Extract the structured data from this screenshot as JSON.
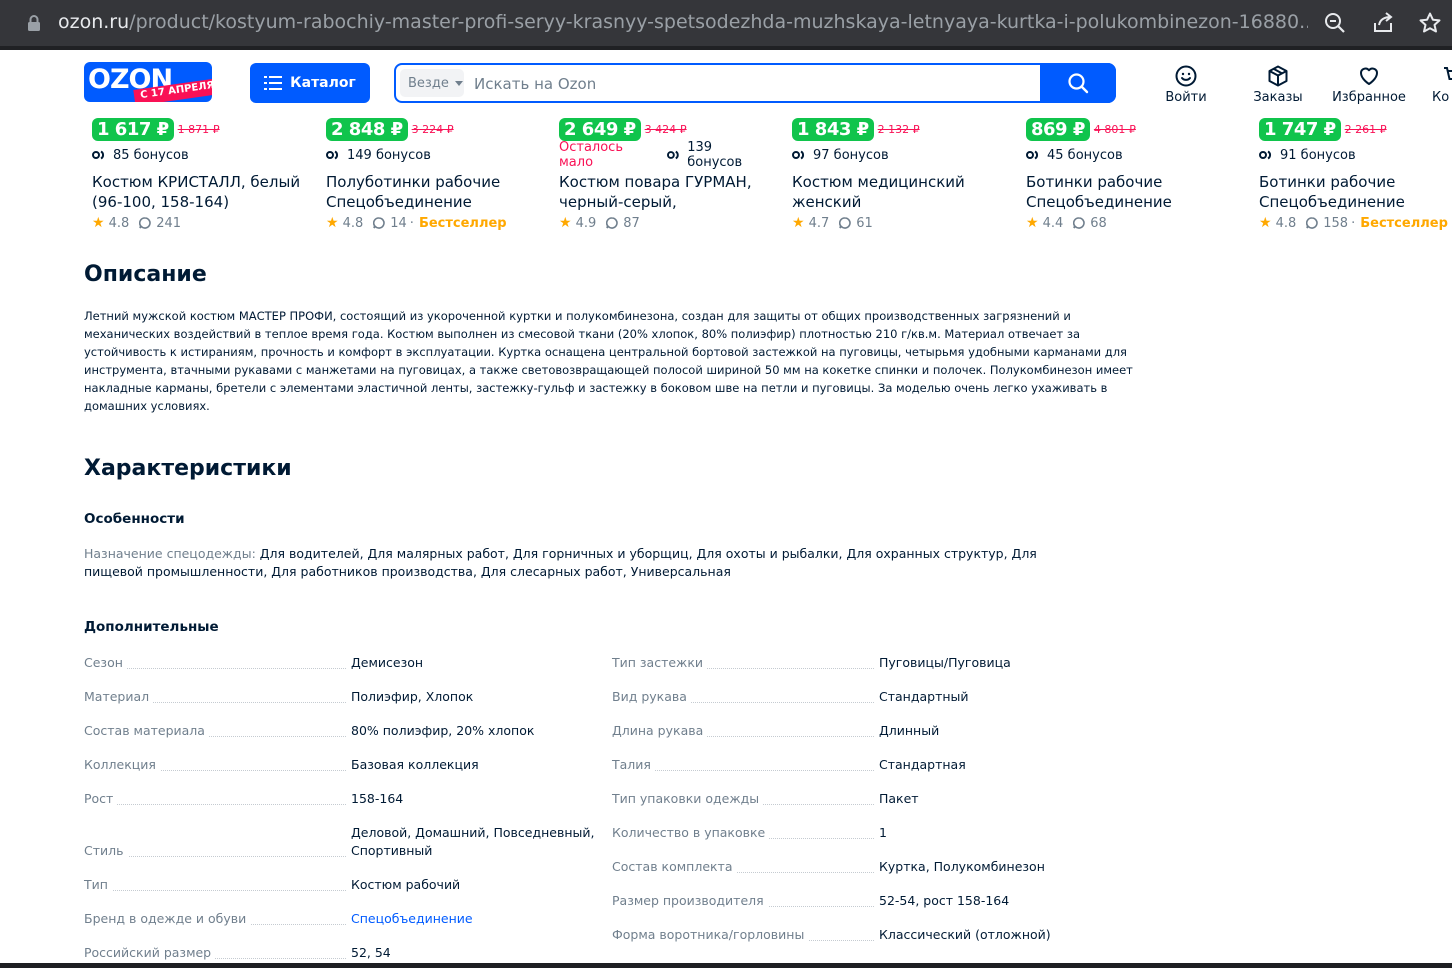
{
  "browser": {
    "url_host": "ozon.ru",
    "url_path": "/product/kostyum-rabochiy-master-profi-seryy-krasnyy-spetsodezhda-muzhskaya-letnyaya-kurtka-i-polukombinezon-16880..."
  },
  "header": {
    "logo_text": "OZON",
    "logo_sub": "С 17 АПРЕЛЯ",
    "catalog_label": "Каталог",
    "search_scope": "Везде",
    "search_placeholder": "Искать на Ozon",
    "actions": [
      {
        "label": "Войти",
        "icon": "smile-icon"
      },
      {
        "label": "Заказы",
        "icon": "box-icon"
      },
      {
        "label": "Избранное",
        "icon": "heart-icon"
      },
      {
        "label": "Ко",
        "icon": "cart-icon"
      }
    ]
  },
  "products": [
    {
      "price": "1 617 ₽",
      "old_price": "1 871 ₽",
      "few_left": "",
      "bonus": "85 бонусов",
      "title": "Костюм КРИСТАЛЛ, белый (96-100, 158-164)",
      "rating": "4.8",
      "reviews": "241",
      "badge": ""
    },
    {
      "price": "2 848 ₽",
      "old_price": "3 224 ₽",
      "few_left": "",
      "bonus": "149 бонусов",
      "title": "Полуботинки рабочие Спецобъединение",
      "rating": "4.8",
      "reviews": "14",
      "badge": "Бестселлер"
    },
    {
      "price": "2 649 ₽",
      "old_price": "3 424 ₽",
      "few_left": "Осталось мало",
      "bonus": "139 бонусов",
      "title": "Костюм повара ГУРМАН, черный-серый, спецодежд...",
      "rating": "4.9",
      "reviews": "87",
      "badge": ""
    },
    {
      "price": "1 843 ₽",
      "old_price": "2 132 ₽",
      "few_left": "",
      "bonus": "97 бонусов",
      "title": "Костюм медицинский женский",
      "rating": "4.7",
      "reviews": "61",
      "badge": ""
    },
    {
      "price": "869 ₽",
      "old_price": "4 801 ₽",
      "few_left": "",
      "bonus": "45 бонусов",
      "title": "Ботинки рабочие Спецобъединение",
      "rating": "4.4",
      "reviews": "68",
      "badge": ""
    },
    {
      "price": "1 747 ₽",
      "old_price": "2 261 ₽",
      "few_left": "",
      "bonus": "91 бонусов",
      "title": "Ботинки рабочие Спецобъединение",
      "rating": "4.8",
      "reviews": "158",
      "badge": "Бестселлер"
    }
  ],
  "description": {
    "heading": "Описание",
    "text": "Летний мужской костюм МАСТЕР ПРОФИ, состоящий из укороченной куртки и полукомбинезона, создан для защиты от общих производственных загрязнений и механических воздействий в теплое время года. Костюм выполнен из смесовой ткани (20% хлопок, 80% полиэфир) плотностью 210 г/кв.м. Материал отвечает за устойчивость к истираниям, прочность и комфорт в эксплуатации. Куртка оснащена центральной бортовой застежкой на пуговицы, четырьмя удобными карманами для инструмента, втачными рукавами с манжетами на пуговицах, а также световозвращающей полосой шириной 50 мм на кокетке спинки и полочек. Полукомбинезон имеет накладные карманы, бретели с элементами эластичной ленты, застежку-гульф и застежку в боковом шве на петли и пуговицы. За моделью очень легко ухаживать в домашних условиях."
  },
  "specs": {
    "heading": "Характеристики",
    "features_title": "Особенности",
    "purpose_key": "Назначение спецодежды:",
    "purpose_value": "Для водителей, Для малярных работ, Для горничных и уборщиц, Для охоты и рыбалки, Для охранных структур, Для пищевой промышленности, Для работников производства, Для слесарных работ, Универсальная",
    "additional_title": "Дополнительные",
    "left": [
      {
        "key": "Сезон",
        "value": "Демисезон"
      },
      {
        "key": "Материал",
        "value": "Полиэфир, Хлопок"
      },
      {
        "key": "Состав материала",
        "value": "80% полиэфир, 20% хлопок"
      },
      {
        "key": "Коллекция",
        "value": "Базовая коллекция"
      },
      {
        "key": "Рост",
        "value": "158-164"
      },
      {
        "key": "Стиль",
        "value": "Деловой, Домашний, Повседневный, Спортивный"
      },
      {
        "key": "Тип",
        "value": "Костюм рабочий"
      },
      {
        "key": "Бренд в одежде и обуви",
        "value": "Спецобъединение"
      },
      {
        "key": "Российский размер",
        "value": "52, 54"
      }
    ],
    "right": [
      {
        "key": "Тип застежки",
        "value": "Пуговицы/Пуговица"
      },
      {
        "key": "Вид рукава",
        "value": "Стандартный"
      },
      {
        "key": "Длина рукава",
        "value": "Длинный"
      },
      {
        "key": "Талия",
        "value": "Стандартная"
      },
      {
        "key": "Тип упаковки одежды",
        "value": "Пакет"
      },
      {
        "key": "Количество в упаковке",
        "value": "1"
      },
      {
        "key": "Состав комплекта",
        "value": "Куртка, Полукомбинезон"
      },
      {
        "key": "Размер производителя",
        "value": "52-54, рост 158-164"
      },
      {
        "key": "Форма воротника/горловины",
        "value": "Классический (отложной)"
      }
    ]
  },
  "colors": {
    "accent": "#005bff",
    "price_green": "#10c44c",
    "sale_red": "#f91155",
    "best": "#ffa800"
  }
}
